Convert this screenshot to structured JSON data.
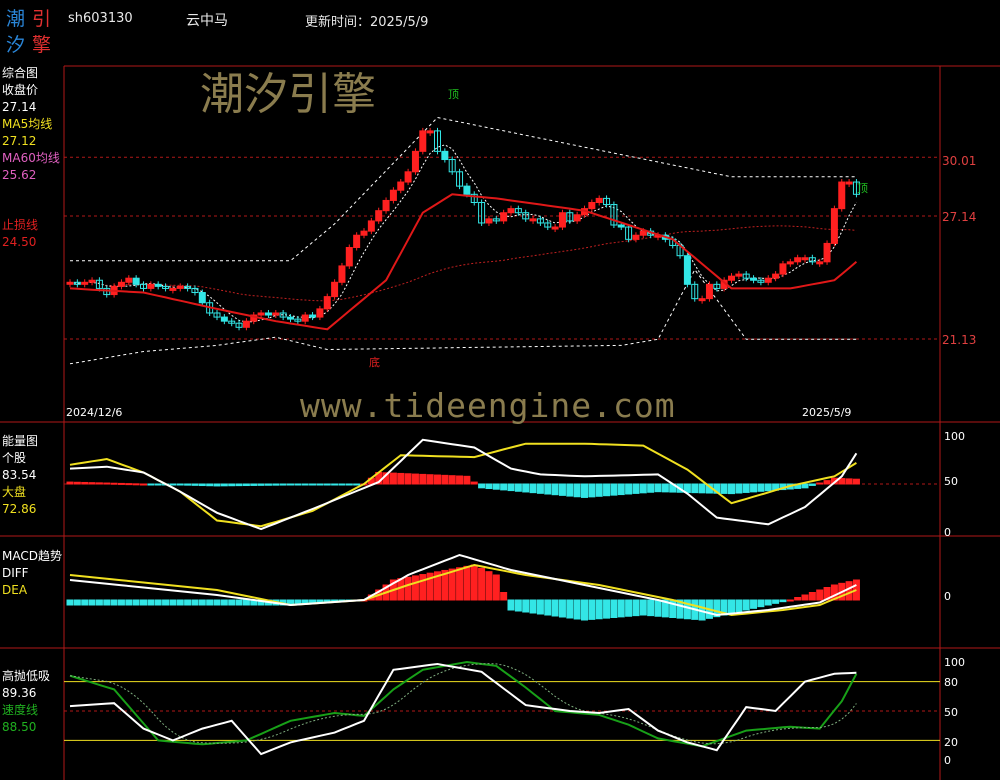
{
  "header": {
    "logo_chars": [
      "潮",
      "引",
      "汐",
      "擎"
    ],
    "stock_code": "sh603130",
    "stock_name": "云中马",
    "update_label": "更新时间：2025/5/9"
  },
  "watermarks": {
    "brand": "潮汐引擎",
    "site": "www.tideengine.com"
  },
  "panel1": {
    "title": "综合图",
    "close_label": "收盘价",
    "close_value": "27.14",
    "ma5_label": "MA5均线",
    "ma5_value": "27.12",
    "ma60_label": "MA60均线",
    "ma60_value": "25.62",
    "stop_label": "止损线",
    "stop_value": "24.50",
    "axis": [
      "30.01",
      "27.14",
      "21.13"
    ],
    "date_start": "2024/12/6",
    "date_end": "2025/5/9",
    "marker_top": "顶",
    "marker_bottom": "底"
  },
  "panel2": {
    "title": "能量图",
    "stock_label": "个股",
    "stock_value": "83.54",
    "market_label": "大盘",
    "market_value": "72.86",
    "axis": [
      "100",
      "50",
      "0"
    ]
  },
  "panel3": {
    "title": "MACD趋势",
    "diff_label": "DIFF",
    "dea_label": "DEA",
    "axis": [
      "0"
    ]
  },
  "panel4": {
    "title": "高抛低吸",
    "main_value": "89.36",
    "speed_label": "速度线",
    "speed_value": "88.50",
    "axis": [
      "100",
      "80",
      "50",
      "20",
      "0"
    ]
  },
  "colors": {
    "up": "#ff2020",
    "down": "#33e6e6",
    "grid": "#b01818",
    "ma_red": "#e01818",
    "white": "#ffffff",
    "yellow": "#f0e020",
    "green": "#18a018"
  },
  "chart_data": [
    {
      "type": "candlestick",
      "title": "综合图",
      "x_range": [
        "2024/12/6",
        "2025/5/9"
      ],
      "y_ticks": [
        30.01,
        27.14,
        21.13
      ],
      "series": [
        {
          "name": "收盘价",
          "last": 27.14
        },
        {
          "name": "MA5均线",
          "last": 27.12
        },
        {
          "name": "MA60均线",
          "last": 25.62
        },
        {
          "name": "止损线",
          "last": 24.5
        }
      ],
      "close": [
        23.9,
        23.8,
        23.9,
        24.0,
        23.6,
        23.3,
        23.7,
        23.9,
        24.1,
        23.8,
        23.6,
        23.8,
        23.7,
        23.6,
        23.6,
        23.7,
        23.6,
        23.4,
        22.9,
        22.4,
        22.2,
        22.0,
        21.9,
        21.7,
        22.0,
        22.3,
        22.4,
        22.3,
        22.4,
        22.2,
        22.1,
        22.0,
        22.3,
        22.2,
        22.6,
        23.2,
        23.9,
        24.7,
        25.6,
        26.2,
        26.4,
        26.9,
        27.4,
        27.9,
        28.4,
        28.8,
        29.3,
        30.3,
        31.3,
        31.3,
        30.3,
        29.9,
        29.3,
        28.6,
        28.2,
        27.8,
        26.8,
        27.0,
        26.9,
        27.3,
        27.5,
        27.3,
        27.0,
        27.0,
        26.8,
        26.6,
        26.6,
        27.3,
        26.9,
        27.2,
        27.5,
        27.8,
        28.0,
        27.7,
        26.7,
        26.6,
        26.0,
        26.2,
        26.4,
        26.2,
        26.2,
        26.0,
        25.7,
        25.2,
        23.8,
        23.1,
        23.1,
        23.8,
        23.6,
        24.0,
        24.2,
        24.3,
        24.1,
        24.0,
        23.9,
        24.1,
        24.3,
        24.8,
        24.9,
        25.1,
        25.1,
        24.9,
        24.9,
        25.8,
        27.5,
        28.8,
        28.8,
        28.2
      ]
    },
    {
      "type": "line",
      "title": "能量图",
      "y_ticks": [
        100,
        50,
        0
      ],
      "series": [
        {
          "name": "个股",
          "last": 83.54
        },
        {
          "name": "大盘",
          "last": 72.86
        }
      ]
    },
    {
      "type": "bar",
      "title": "MACD趋势",
      "y_ticks": [
        0
      ],
      "series": [
        {
          "name": "DIFF"
        },
        {
          "name": "DEA"
        }
      ]
    },
    {
      "type": "line",
      "title": "高抛低吸",
      "y_ticks": [
        100,
        80,
        50,
        20,
        0
      ],
      "series": [
        {
          "name": "高抛低吸",
          "last": 89.36
        },
        {
          "name": "速度线",
          "last": 88.5
        }
      ]
    }
  ]
}
